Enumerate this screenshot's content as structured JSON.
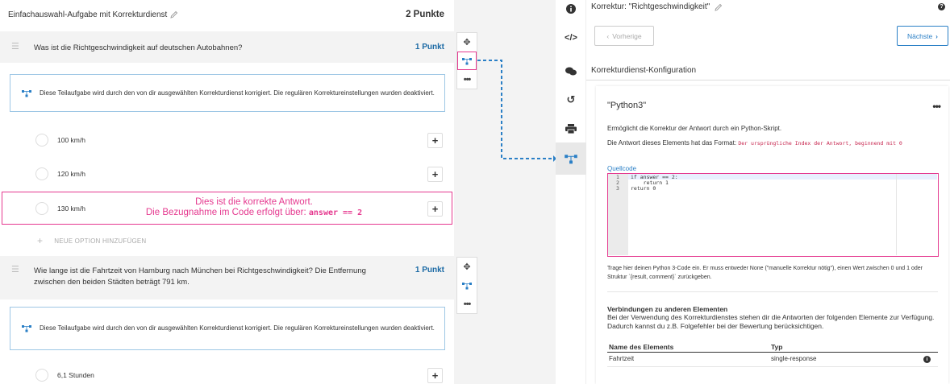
{
  "task": {
    "title": "Einfachauswahl-Aufgabe mit Korrekturdienst",
    "points": "2 Punkte"
  },
  "subtask1": {
    "question": "Was ist die Richtgeschwindigkeit auf deutschen Autobahnen?",
    "points": "1 Punkt",
    "info": "Diese Teilaufgabe wird durch den von dir ausgewählten Korrekturdienst korrigiert. Die regulären Korrektureinstellungen wurden deaktiviert.",
    "options": [
      "100 km/h",
      "120 km/h",
      "130 km/h"
    ],
    "new_option": "NEUE OPTION HINZUFÜGEN"
  },
  "annotation": {
    "line1": "Dies ist die korrekte Antwort.",
    "line2": "Die Bezugnahme im Code erfolgt über:",
    "code": "answer == 2"
  },
  "subtask2": {
    "question": "Wie lange ist die Fahrtzeit von Hamburg nach München bei Richtgeschwindigkeit? Die Entfernung zwischen den beiden Städten beträgt 791 km.",
    "points": "1 Punkt",
    "info": "Diese Teilaufgabe wird durch den von dir ausgewählten Korrekturdienst korrigiert. Die regulären Korrektureinstellungen wurden deaktiviert.",
    "options": [
      "6,1 Stunden"
    ]
  },
  "right": {
    "title": "Korrektur: \"Richtgeschwindigkeit\"",
    "prev_label": "Vorherige",
    "next_label": "Nächste",
    "section_title": "Korrekturdienst-Konfiguration",
    "card": {
      "title": "\"Python3\"",
      "more": "•••",
      "desc": "Ermöglicht die Korrektur der Antwort durch ein Python-Skript.",
      "format_prefix": "Die Antwort dieses Elements hat das Format:",
      "format_code": "Der ursprüngliche Index der Antwort, beginnend mit 0",
      "source_label": "Quellcode",
      "code_lines": [
        {
          "num": "1",
          "text": "if answer == 2:"
        },
        {
          "num": "2",
          "text": "    return 1"
        },
        {
          "num": "3",
          "text": "return 0"
        }
      ],
      "help": "Trage hier deinen Python 3-Code ein. Er muss entweder None (\"manuelle Korrektur nötig\"), einen Wert zwischen 0 und 1 oder Struktur `{result, comment}` zurückgeben.",
      "connections_title": "Verbindungen zu anderen Elementen",
      "connections_desc": "Bei der Verwendung des Korrekturdienstes stehen dir die Antworten der folgenden Elemente zur Verfügung. Dadurch kannst du z.B. Folgefehler bei der Bewertung berücksichtigen.",
      "table": {
        "headers": [
          "Name des Elements",
          "Typ"
        ],
        "rows": [
          {
            "name": "Fahrtzeit",
            "type": "single-response"
          }
        ]
      }
    }
  },
  "colors": {
    "accent": "#2a7fc6",
    "highlight": "#e5398f"
  }
}
